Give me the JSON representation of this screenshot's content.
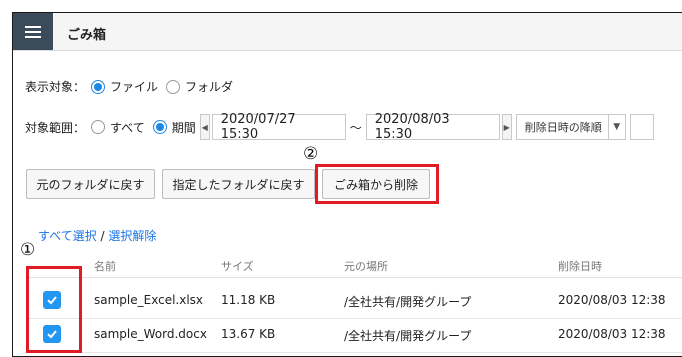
{
  "header": {
    "title": "ごみ箱"
  },
  "display_target": {
    "label": "表示対象：",
    "options": [
      {
        "label": "ファイル",
        "selected": true
      },
      {
        "label": "フォルダ",
        "selected": false
      }
    ]
  },
  "target_range": {
    "label": "対象範囲：",
    "options": [
      {
        "label": "すべて",
        "selected": false
      },
      {
        "label": "期間",
        "selected": true
      }
    ],
    "start": "2020/07/27 15:30",
    "separator": "～",
    "end": "2020/08/03 15:30",
    "sort": "削除日時の降順"
  },
  "buttons": {
    "restore_original": "元のフォルダに戻す",
    "restore_specified": "指定したフォルダに戻す",
    "delete_from_trash": "ごみ箱から削除"
  },
  "annotations": {
    "one": "①",
    "two": "②"
  },
  "selection": {
    "select_all": "すべて選択",
    "separator": " / ",
    "deselect": "選択解除"
  },
  "table": {
    "headers": [
      "名前",
      "サイズ",
      "元の場所",
      "削除日時"
    ],
    "rows": [
      {
        "checked": true,
        "name": "sample_Excel.xlsx",
        "size": "11.18 KB",
        "location": "/全社共有/開発グループ",
        "deleted": "2020/08/03 12:38"
      },
      {
        "checked": true,
        "name": "sample_Word.docx",
        "size": "13.67 KB",
        "location": "/全社共有/開発グループ",
        "deleted": "2020/08/03 12:38"
      }
    ]
  },
  "colors": {
    "accent": "#1e88e5",
    "highlight": "#e01b24",
    "menu_bg": "#3c4b5a"
  }
}
